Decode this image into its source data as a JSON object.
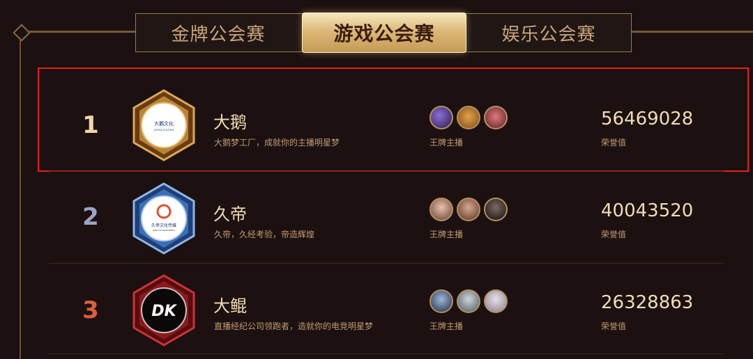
{
  "tabs": [
    {
      "label": "金牌公会赛",
      "active": false
    },
    {
      "label": "游戏公会赛",
      "active": true
    },
    {
      "label": "娱乐公会赛",
      "active": false
    }
  ],
  "guilds": [
    {
      "rank": "1",
      "rank_color": "#f0d7a8",
      "name": "大鹅",
      "slogan": "大鹅梦工厂，成就你的主播明星梦",
      "logo_text": "大鵝文化",
      "logo_subtext": "GOOSE CULTURE",
      "badge_icon": "gold-hexagon-badge",
      "anchors_label": "王牌主播",
      "score": "56469028",
      "score_label": "荣誉值"
    },
    {
      "rank": "2",
      "rank_color": "#9aa4c6",
      "name": "久帝",
      "slogan": "久帝，久经考验，帝造辉煌",
      "logo_text": "久帝文化传媒",
      "logo_subtext": "JIUDI CULTURE MEDIA",
      "badge_icon": "silver-hexagon-badge",
      "anchors_label": "王牌主播",
      "score": "40043520",
      "score_label": "荣誉值"
    },
    {
      "rank": "3",
      "rank_color": "#d9603a",
      "name": "大鲲",
      "slogan": "直播经纪公司领跑者，造就你的电竞明星梦",
      "logo_text": "DK",
      "logo_subtext": "",
      "badge_icon": "red-hexagon-badge",
      "anchors_label": "王牌主播",
      "score": "26328863",
      "score_label": "荣誉值"
    }
  ],
  "colors": {
    "background": "#1c1110",
    "accent_gold": "#dcb878",
    "highlight_border": "#e0201e"
  }
}
